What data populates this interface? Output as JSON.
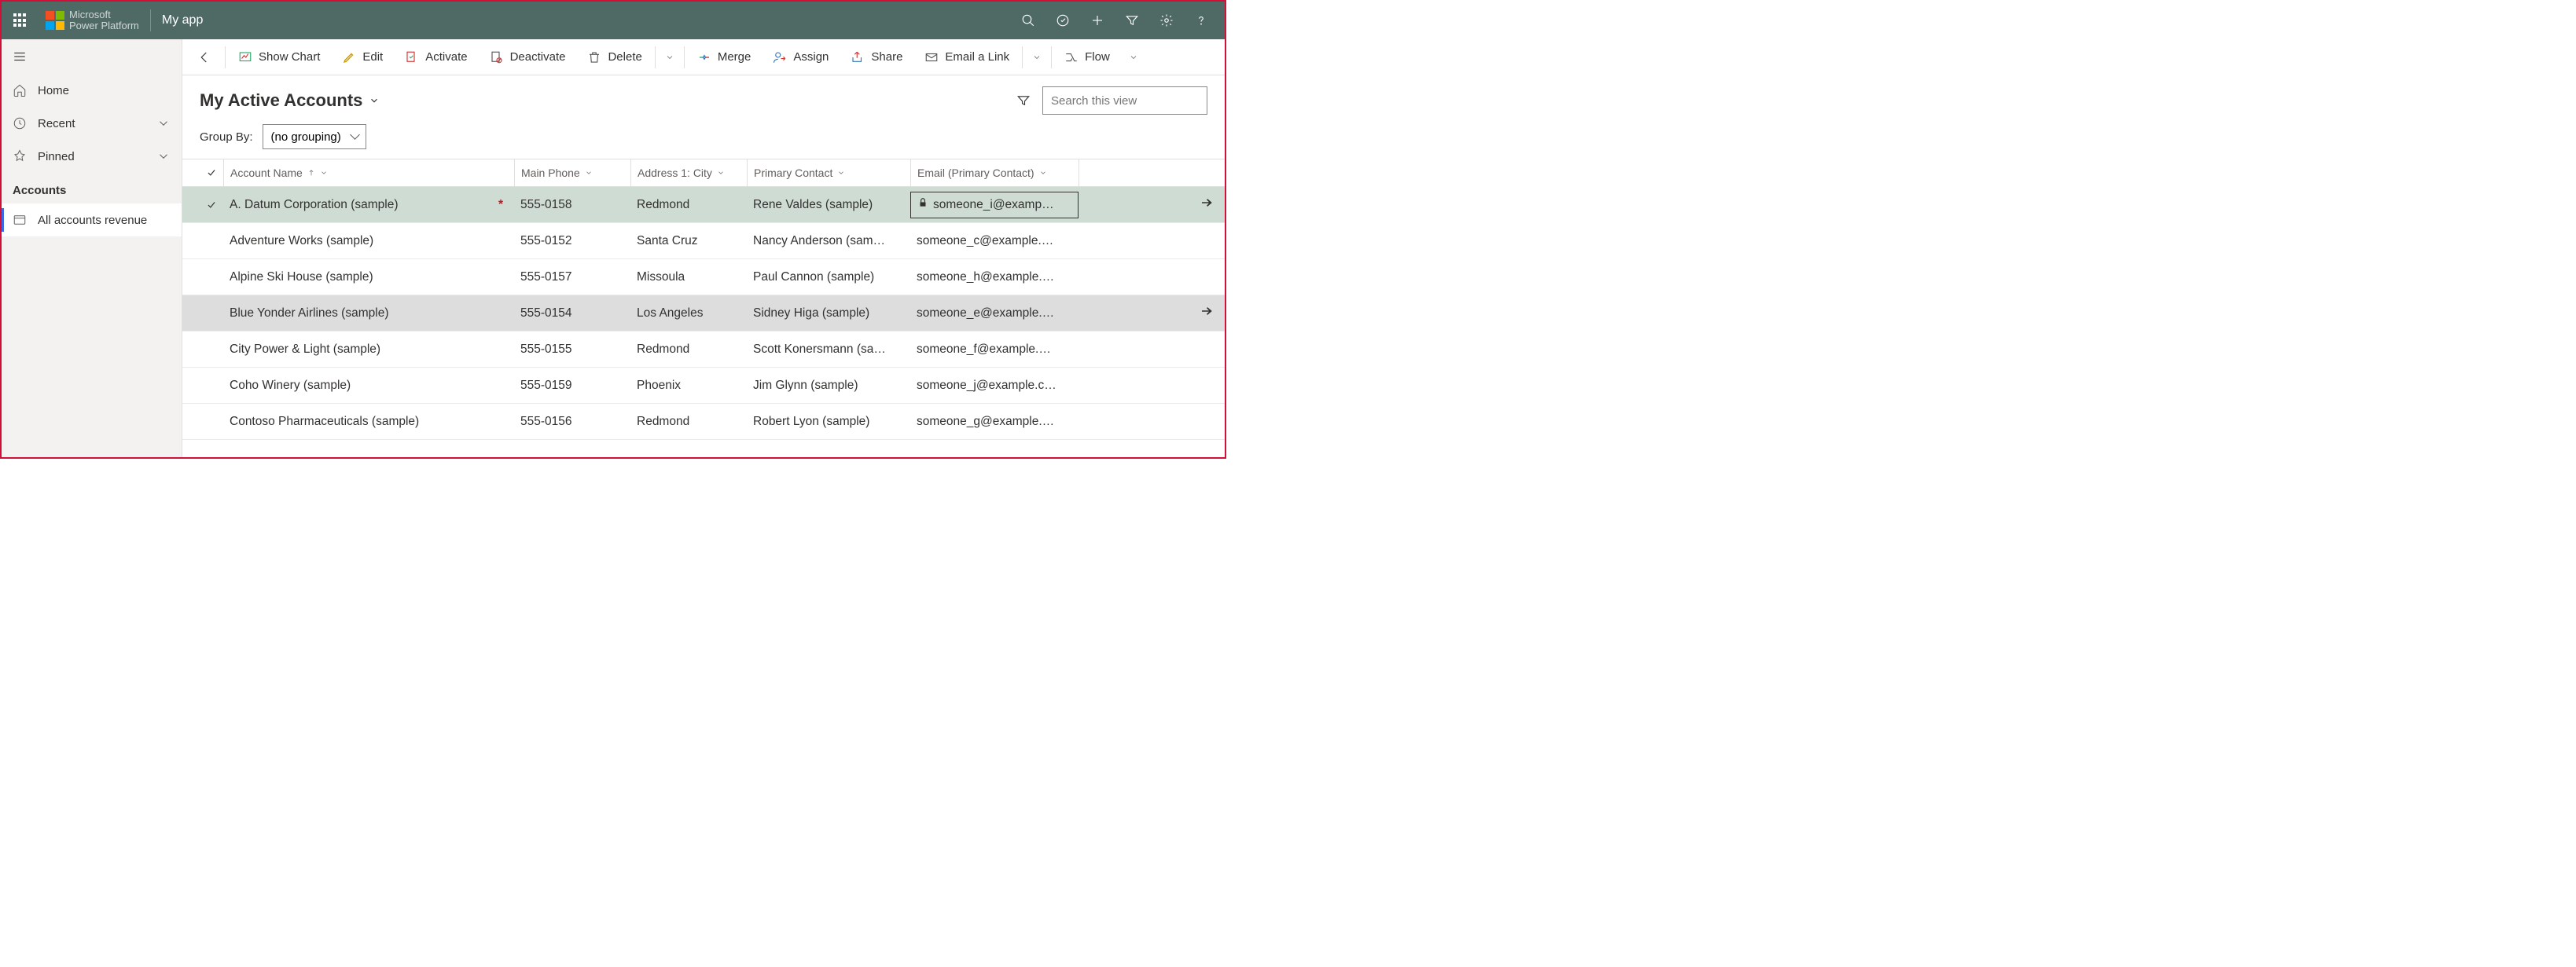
{
  "topbar": {
    "brand_line1": "Microsoft",
    "brand_line2": "Power Platform",
    "app_name": "My app"
  },
  "sidebar": {
    "home": "Home",
    "recent": "Recent",
    "pinned": "Pinned",
    "section": "Accounts",
    "view_item": "All accounts revenue"
  },
  "commands": {
    "show_chart": "Show Chart",
    "edit": "Edit",
    "activate": "Activate",
    "deactivate": "Deactivate",
    "delete": "Delete",
    "merge": "Merge",
    "assign": "Assign",
    "share": "Share",
    "email_link": "Email a Link",
    "flow": "Flow"
  },
  "view": {
    "title": "My Active Accounts",
    "search_placeholder": "Search this view",
    "group_by_label": "Group By:",
    "group_by_value": "(no grouping)"
  },
  "columns": {
    "name": "Account Name",
    "phone": "Main Phone",
    "city": "Address 1: City",
    "contact": "Primary Contact",
    "email": "Email (Primary Contact)"
  },
  "rows": [
    {
      "name": "A. Datum Corporation (sample)",
      "phone": "555-0158",
      "req": true,
      "city": "Redmond",
      "contact": "Rene Valdes (sample)",
      "email": "someone_i@examp…",
      "lock": true,
      "selected": true,
      "arrow": true
    },
    {
      "name": "Adventure Works (sample)",
      "phone": "555-0152",
      "city": "Santa Cruz",
      "contact": "Nancy Anderson (sam…",
      "email": "someone_c@example.…"
    },
    {
      "name": "Alpine Ski House (sample)",
      "phone": "555-0157",
      "city": "Missoula",
      "contact": "Paul Cannon (sample)",
      "email": "someone_h@example.…"
    },
    {
      "name": "Blue Yonder Airlines (sample)",
      "phone": "555-0154",
      "city": "Los Angeles",
      "contact": "Sidney Higa (sample)",
      "email": "someone_e@example.…",
      "hover": true,
      "arrow": true
    },
    {
      "name": "City Power & Light (sample)",
      "phone": "555-0155",
      "city": "Redmond",
      "contact": "Scott Konersmann (sa…",
      "email": "someone_f@example.…"
    },
    {
      "name": "Coho Winery (sample)",
      "phone": "555-0159",
      "city": "Phoenix",
      "contact": "Jim Glynn (sample)",
      "email": "someone_j@example.c…"
    },
    {
      "name": "Contoso Pharmaceuticals (sample)",
      "phone": "555-0156",
      "city": "Redmond",
      "contact": "Robert Lyon (sample)",
      "email": "someone_g@example.…"
    }
  ]
}
